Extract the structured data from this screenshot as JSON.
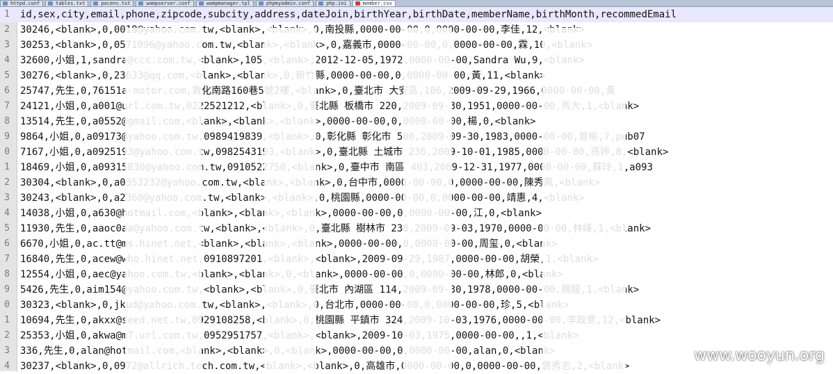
{
  "tabs": [
    {
      "label": "httpd.conf",
      "active": false
    },
    {
      "label": "tables.txt",
      "active": false
    },
    {
      "label": "pacenv.txt",
      "active": false
    },
    {
      "label": "wampserver.conf",
      "active": false
    },
    {
      "label": "wampmanager.tpl",
      "active": false
    },
    {
      "label": "phpmyadmin.conf",
      "active": false
    },
    {
      "label": "php.ini",
      "active": false
    },
    {
      "label": "member.csv",
      "active": true
    }
  ],
  "lines": [
    {
      "num": "1",
      "text": "id,sex,city,email,phone,zipcode,subcity,address,dateJoin,birthYear,birthDate,memberName,birthMonth,recommedEmail"
    },
    {
      "num": "2",
      "text": "30246,<blank>,0,0018@yahoo.com.tw,<blank>,<blank>,0,南投縣,0000-00-00,0,0000-00-00,李佳,12,<blank>"
    },
    {
      "num": "3",
      "text": "30253,<blank>,0,0571096@yahoo.com.tw,<blank>,<blank>,0,嘉義市,0000-00-00,0,0000-00-00,霖,10,<blank>"
    },
    {
      "num": "4",
      "text": "32600,小姐,1,sandra@ccc.com.tw,<blank>,105,<blank>,2012-12-05,1972,0000-00-00,Sandra Wu,9,<blank>"
    },
    {
      "num": "5",
      "text": "30276,<blank>,0,23633@qq.com,<blank>,<blank>,0,新竹縣,0000-00-00,0,0000-00-00,黃,11,<blank>"
    },
    {
      "num": "6",
      "text": "25747,先生,0,76151a-motor.com,敦化南路160巷5號2樓,<blank>,0,臺北市 大安區,106,2009-09-29,1966,0000-00-00,黃"
    },
    {
      "num": "7",
      "text": "24121,小姐,0,a001@url.com.tw,0222521212,<blank>,0,臺北縣 板橋市 220,2009-09-30,1951,0000-00-00,馬大,1,<blank>"
    },
    {
      "num": "8",
      "text": "13514,先生,0,a0552@gmail.com,<blank>,<blank>,<blank>,0000-00-00,0,0000-00-00,楊,0,<blank>"
    },
    {
      "num": "9",
      "text": "9864,小姐,0,a09173@yahoo.com.tw,0989419839,<blank>,0,彰化縣 彰化市 500,2009-09-30,1983,0000-00-00,曾榆,7,pub07"
    },
    {
      "num": "0",
      "text": "7167,小姐,0,a0925193@yahoo.com.tw,0982543193,<blank>,0,臺北縣 土城市 236,2009-10-01,1985,0000-00-00,孫婷,8,<blank>"
    },
    {
      "num": "1",
      "text": "18469,小姐,0,a09315830@yahoo.com.tw,0910522750,<blank>,0,臺中市 南區 403,2009-12-31,1977,0000-00-00,蘇玲,1,a093"
    },
    {
      "num": "2",
      "text": "30304,<blank>,0,a0353232@yahoo.com.tw,<blank>,<blank>,0,台中市,0000-00-00,0,0000-00-00,陳秀鳳,<blank>"
    },
    {
      "num": "3",
      "text": "30243,<blank>,0,a2360@yahoo.com.tw,<blank>,<blank>,0,桃園縣,0000-00-00,0,0000-00-00,靖惠,4,<blank>"
    },
    {
      "num": "4",
      "text": "14038,小姐,0,a630@hotmail.com,<blank>,<blank>,<blank>,0000-00-00,0,0000-00-00,江,0,<blank>"
    },
    {
      "num": "5",
      "text": "11930,先生,0,aaoc0aa@yahoo.com.tw,<blank>,<blank>,0,臺北縣 樹林市 238,2009-09-03,1970,0000-00-00,林峰,1,<blank>"
    },
    {
      "num": "6",
      "text": "6670,小姐,0,ac.tt@ms.hinet.net,<blank>,<blank>,<blank>,0000-00-00,0,0000-00-00,周玺,0,<blank>"
    },
    {
      "num": "7",
      "text": "16840,先生,0,acew@who.hinet.net,0910897201,<blank>,<blank>,2009-09-29,1987,0000-00-00,胡榮,1,<blank>"
    },
    {
      "num": "8",
      "text": "12554,小姐,0,aec@yahoo.com.tw,<blank>,<blank>,0,<blank>,0000-00-00,0,0000-00-00,林郎,0,<blank>"
    },
    {
      "num": "9",
      "text": "5426,先生,0,aim154@yahoo.com.tw,<blank>,<blank>,0,臺北市 內湖區 114,2009-09-30,1978,0000-00-00,親龍,1,<blank>"
    },
    {
      "num": "0",
      "text": "30323,<blank>,0,jkud@yahoo.com.tw,<blank>,<blank>,0,台北市,0000-00-00,0,0000-00-00,珍,5,<blank>"
    },
    {
      "num": "1",
      "text": "10694,先生,0,akxx@seed.net.tw,0929108258,<blank>,0,桃園縣 平鎮市 324,2009-10-03,1976,0000-00-00,李政意,12,<blank>"
    },
    {
      "num": "2",
      "text": "25353,小姐,0,akwa@m7.url.com.tw,0952951757,<blank>,<blank>,2009-10-03,1975,0000-00-00,,1,<blank>"
    },
    {
      "num": "3",
      "text": "336,先生,0,alan@hotmail.com,<blank>,<blank>,0,<blank>,0000-00-00,0,0000-00-00,alan,0,<blank>"
    },
    {
      "num": "4",
      "text": "30237,<blank>,0,0972@allrich.tech.com.tw,<blank>,<blank>,0,高雄市,0000-00-00,0,0000-00-00,曾秀志,2,<blank>"
    }
  ],
  "watermark": "www.wooyun.org"
}
